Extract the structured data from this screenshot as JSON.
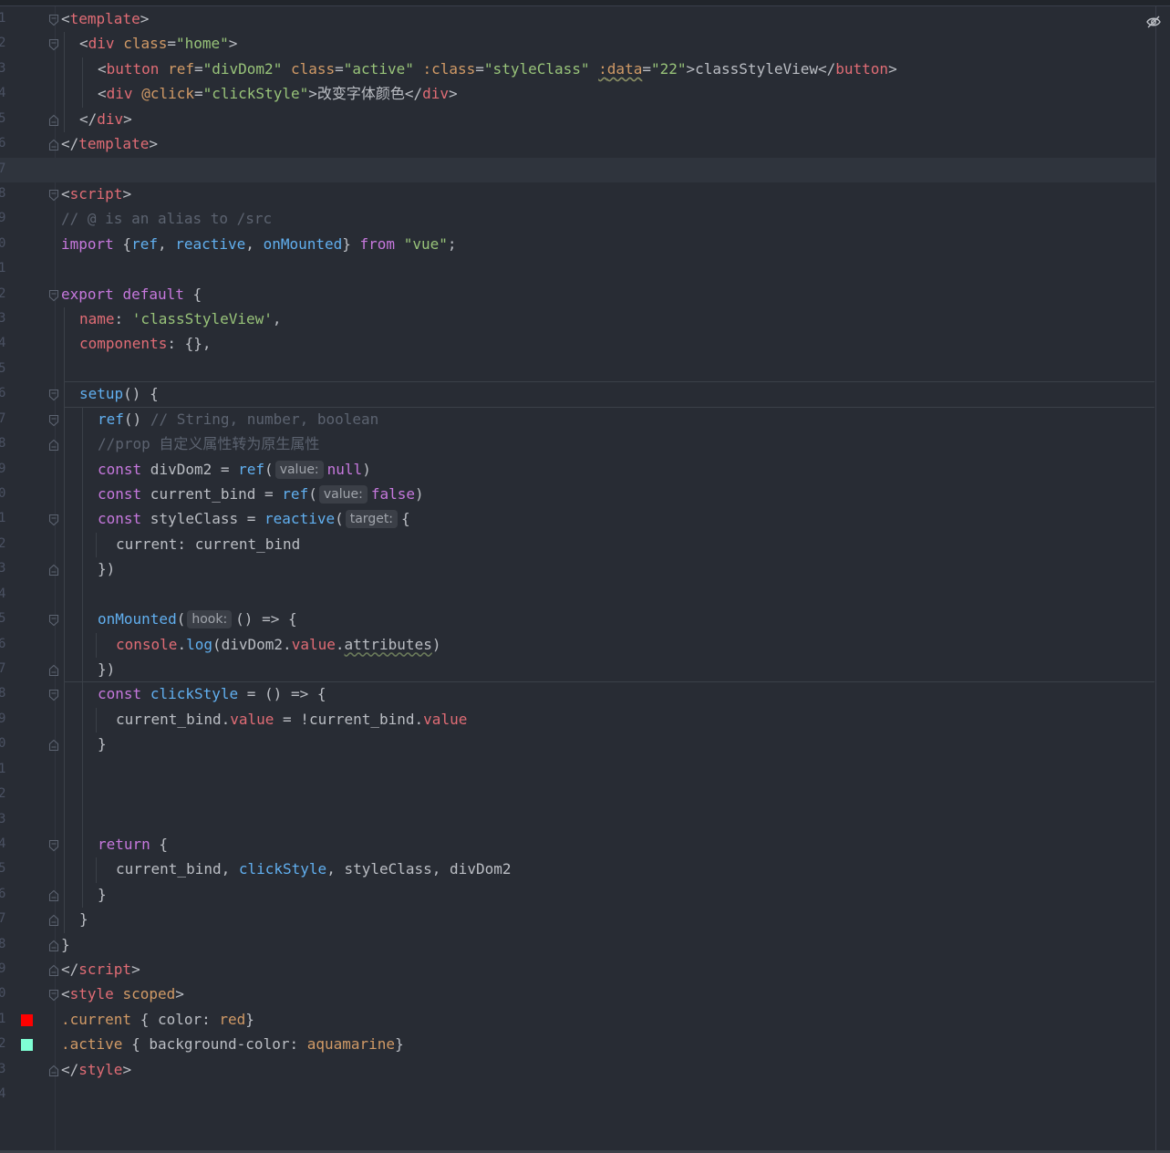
{
  "editor": {
    "line_numbers": [
      "1",
      "2",
      "3",
      "4",
      "5",
      "6",
      "7",
      "8",
      "9",
      "0",
      "1",
      "2",
      "3",
      "4",
      "5",
      "6",
      "7",
      "8",
      "9",
      "0",
      "1",
      "2",
      "3",
      "4",
      "5",
      "6",
      "7",
      "8",
      "9",
      "0",
      "1",
      "2",
      "3",
      "4",
      "5",
      "6",
      "7",
      "8",
      "9",
      "0",
      "1",
      "2",
      "3",
      "4"
    ],
    "current_line": 7,
    "swatches": {
      "line_41": "#ff0000",
      "line_42": "#7fffd4"
    },
    "reader_mode_icon": "eye-slash-icon"
  },
  "code": {
    "l1": [
      "<",
      "template",
      ">"
    ],
    "l2": [
      "<",
      "div",
      " ",
      "class",
      "=",
      "\"home\"",
      ">"
    ],
    "l3": [
      "<",
      "button",
      " ",
      "ref",
      "=",
      "\"divDom2\"",
      " ",
      "class",
      "=",
      "\"active\"",
      " ",
      ":class",
      "=",
      "\"styleClass\"",
      " ",
      ":",
      "data",
      "=",
      "\"22\"",
      ">classStyleView</",
      "button",
      ">"
    ],
    "l4": [
      "<",
      "div",
      " ",
      "@click",
      "=",
      "\"clickStyle\"",
      ">改变字体颜色</",
      "div",
      ">"
    ],
    "l5": [
      "</",
      "div",
      ">"
    ],
    "l6": [
      "</",
      "template",
      ">"
    ],
    "l8": [
      "<",
      "script",
      ">"
    ],
    "l9": "// @ is an alias to /src",
    "l10": [
      "import",
      " {",
      "ref",
      ", ",
      "reactive",
      ", ",
      "onMounted",
      "} ",
      "from",
      " ",
      "\"vue\"",
      ";"
    ],
    "l12": [
      "export",
      " ",
      "default",
      " {"
    ],
    "l13": [
      "name",
      ": ",
      "'classStyleView'",
      ","
    ],
    "l14": [
      "components",
      ": {},"
    ],
    "l16": [
      "setup",
      "() {"
    ],
    "l17": [
      "ref",
      "() ",
      "// String, number, boolean"
    ],
    "l18": "//prop 自定义属性转为原生属性",
    "l19": [
      "const",
      " divDom2 = ",
      "ref",
      "(",
      "value:",
      "null",
      ")"
    ],
    "l20": [
      "const",
      " current_bind = ",
      "ref",
      "(",
      "value:",
      "false",
      ")"
    ],
    "l21": [
      "const",
      " styleClass = ",
      "reactive",
      "(",
      "target:",
      "{"
    ],
    "l22": "current: current_bind",
    "l23": "})",
    "l25": [
      "onMounted",
      "(",
      "hook:",
      "() => {"
    ],
    "l26": [
      "console",
      ".",
      "log",
      "(divDom2.",
      "value",
      ".",
      "attributes",
      ")"
    ],
    "l27": "})",
    "l28": [
      "const",
      " ",
      "clickStyle",
      " = () => {"
    ],
    "l29": [
      "current_bind.",
      "value",
      " = !current_bind.",
      "value"
    ],
    "l30": "}",
    "l34": [
      "return",
      " {"
    ],
    "l35": [
      "current_bind, ",
      "clickStyle",
      ", styleClass, divDom2"
    ],
    "l36": "}",
    "l37": "}",
    "l38": "}",
    "l39": [
      "</",
      "script",
      ">"
    ],
    "l40": [
      "<",
      "style",
      " ",
      "scoped",
      ">"
    ],
    "l41": [
      ".current",
      " { color: ",
      "red",
      "}"
    ],
    "l42": [
      ".active",
      " { background-color: ",
      "aquamarine",
      "}"
    ],
    "l43": [
      "</",
      "style",
      ">"
    ]
  }
}
